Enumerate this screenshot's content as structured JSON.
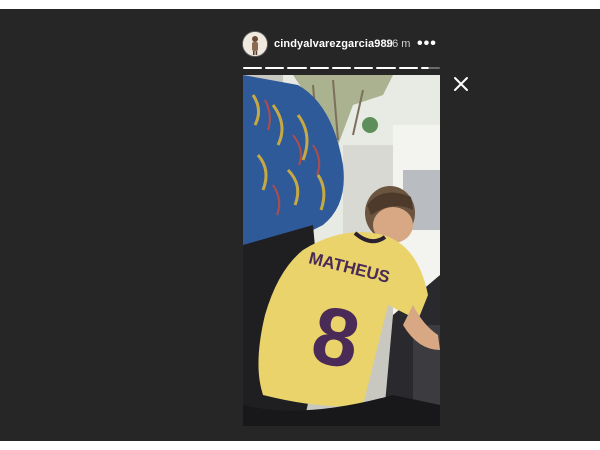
{
  "story": {
    "username": "cindyalvarezgarcia989",
    "timestamp": "26 m",
    "more_icon": "more-horizontal-icon",
    "close_icon": "close-icon",
    "segments_total": 9,
    "segments_viewed": 8,
    "current_segment_progress": 0.4,
    "image": {
      "jersey_name": "MATHEUS",
      "jersey_number": "8"
    }
  },
  "colors": {
    "backdrop": "#262626",
    "jersey": "#e9d36a",
    "seat_blue": "#2f5a9a"
  }
}
